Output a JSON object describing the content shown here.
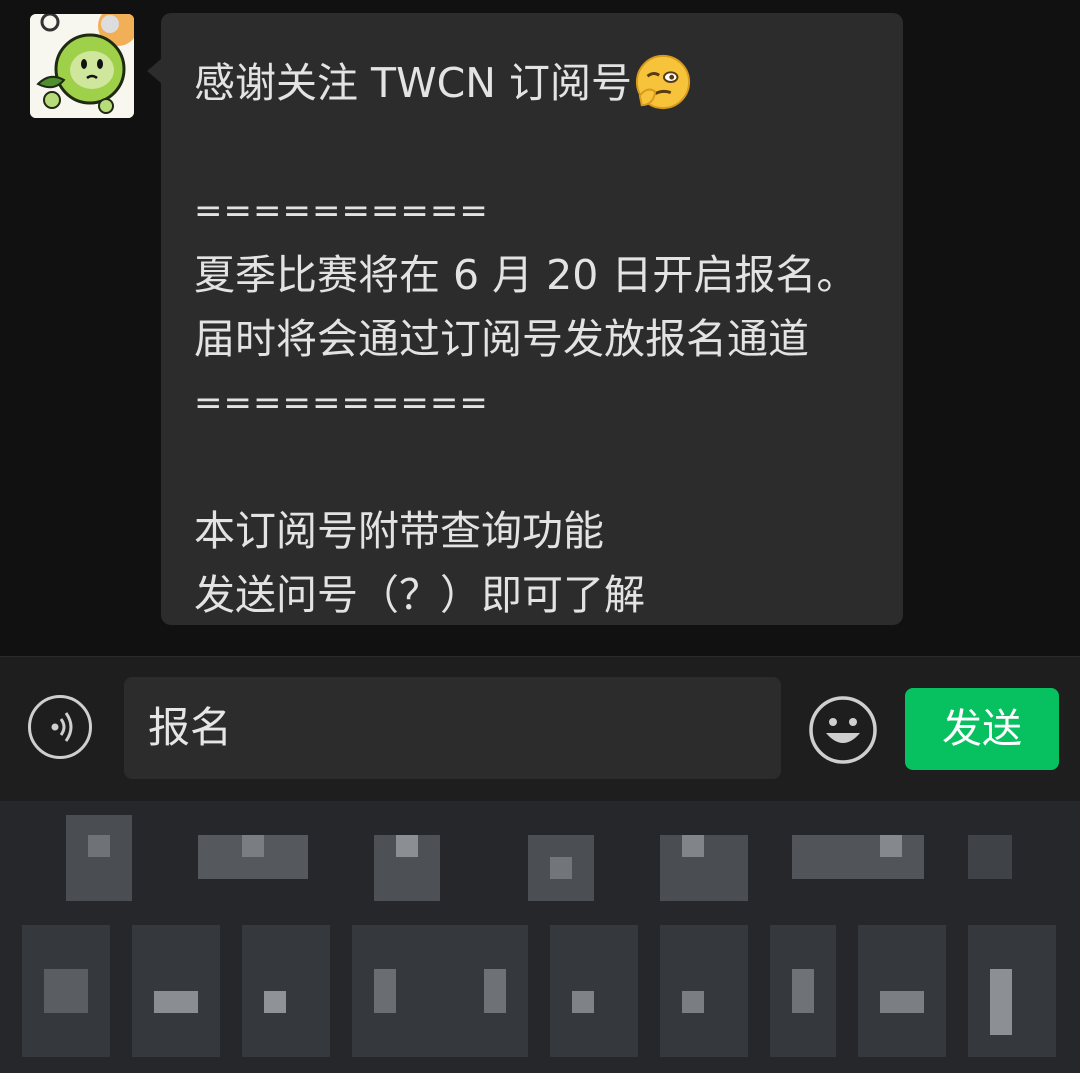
{
  "chat": {
    "lines": [
      "感谢关注 TWCN 订阅号",
      "",
      "==========",
      "夏季比赛将在 6 月 20 日开启报名。",
      "届时将会通过订阅号发放报名通道",
      "==========",
      "",
      "本订阅号附带查询功能",
      "发送问号（？）即可了解"
    ]
  },
  "input_bar": {
    "message_value": "报名",
    "send_label": "发送"
  },
  "colors": {
    "send_button": "#07c160",
    "bubble": "#2c2c2c",
    "background": "#111111"
  },
  "icons": [
    "avatar",
    "wink-emoji-icon",
    "voice-icon",
    "emoji-icon"
  ]
}
